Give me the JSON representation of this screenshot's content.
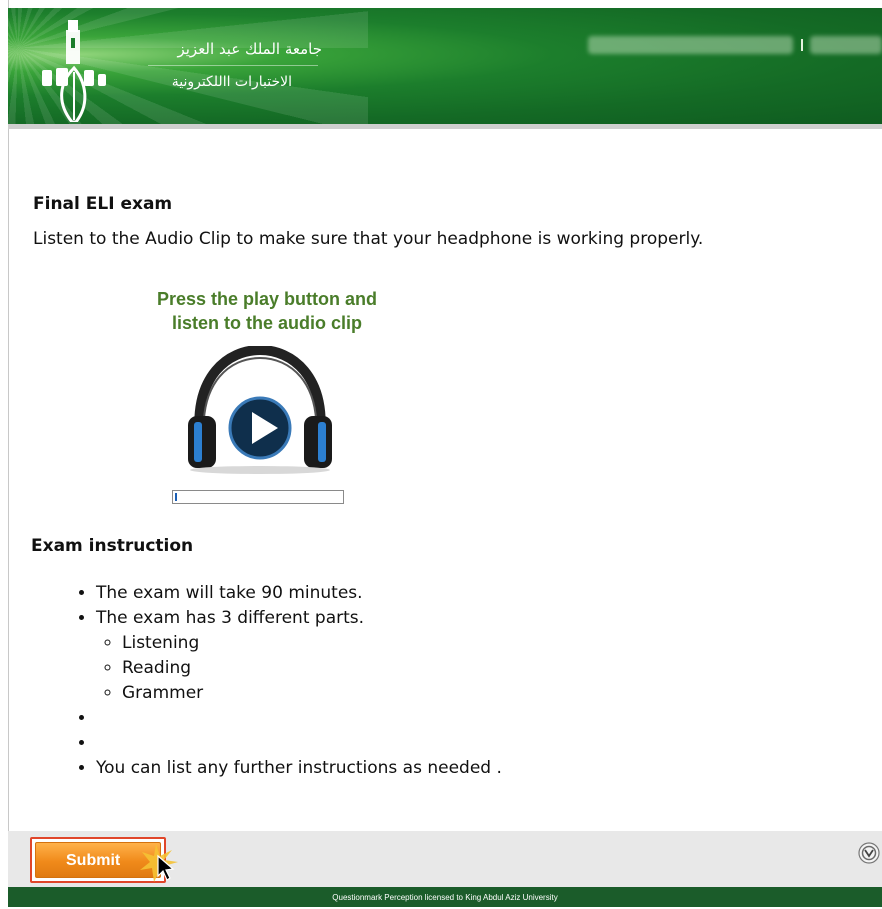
{
  "header": {
    "university_name": "جامعة الملك عبد العزيز",
    "system_name": "الاختبارات االلكترونية"
  },
  "exam": {
    "title": "Final ELI exam",
    "lead": "Listen to the Audio Clip to make sure that your headphone is working properly."
  },
  "audio": {
    "prompt_line1": "Press the play button and",
    "prompt_line2": "listen to the audio clip",
    "progress_fraction": 0.01
  },
  "instructions": {
    "title": "Exam instruction",
    "items": [
      "The exam will take 90 minutes.",
      "The exam has 3 different parts."
    ],
    "parts": [
      "Listening",
      "Reading",
      "Grammer"
    ],
    "last_item": "You can list any further instructions as needed ."
  },
  "footer": {
    "submit_label": "Submit",
    "license_text": "Questionmark Perception licensed to King Abdul Aziz University"
  },
  "colors": {
    "header_green": "#146a25",
    "prompt_green": "#4a7d2a",
    "submit_orange": "#f08a1a",
    "bottom_bar": "#1b5c2a"
  },
  "icons": {
    "logo": "kau-logo-icon",
    "play": "play-icon",
    "headphones": "headphones-icon",
    "help": "help-icon",
    "cursor": "cursor-icon"
  }
}
